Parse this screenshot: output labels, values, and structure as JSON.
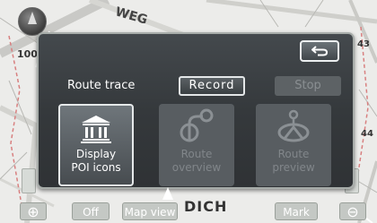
{
  "map": {
    "street_weg": "WEG",
    "street_dich": "DICH",
    "label_100": "100",
    "label_43": "43",
    "label_44": "44",
    "buttons": {
      "zoom_in": "⊕",
      "off": "Off",
      "map_view": "Map view",
      "mark": "Mark",
      "zoom_out": "⊖"
    }
  },
  "dialog": {
    "back_icon": "return-arrow-icon",
    "route_trace_label": "Route trace",
    "record_label": "Record",
    "stop_label": "Stop",
    "tiles": [
      {
        "icon": "museum-building-icon",
        "line1": "Display",
        "line2": "POI icons",
        "enabled": true
      },
      {
        "icon": "route-overview-icon",
        "line1": "Route",
        "line2": "overview",
        "enabled": false
      },
      {
        "icon": "route-preview-icon",
        "line1": "Route",
        "line2": "preview",
        "enabled": false
      }
    ]
  },
  "colors": {
    "dialog_bg": "#35393c",
    "dialog_border": "#a7aca9",
    "button_border_active": "#e4e7e8",
    "disabled_text": "#81868a",
    "map_bg": "#ececea"
  }
}
